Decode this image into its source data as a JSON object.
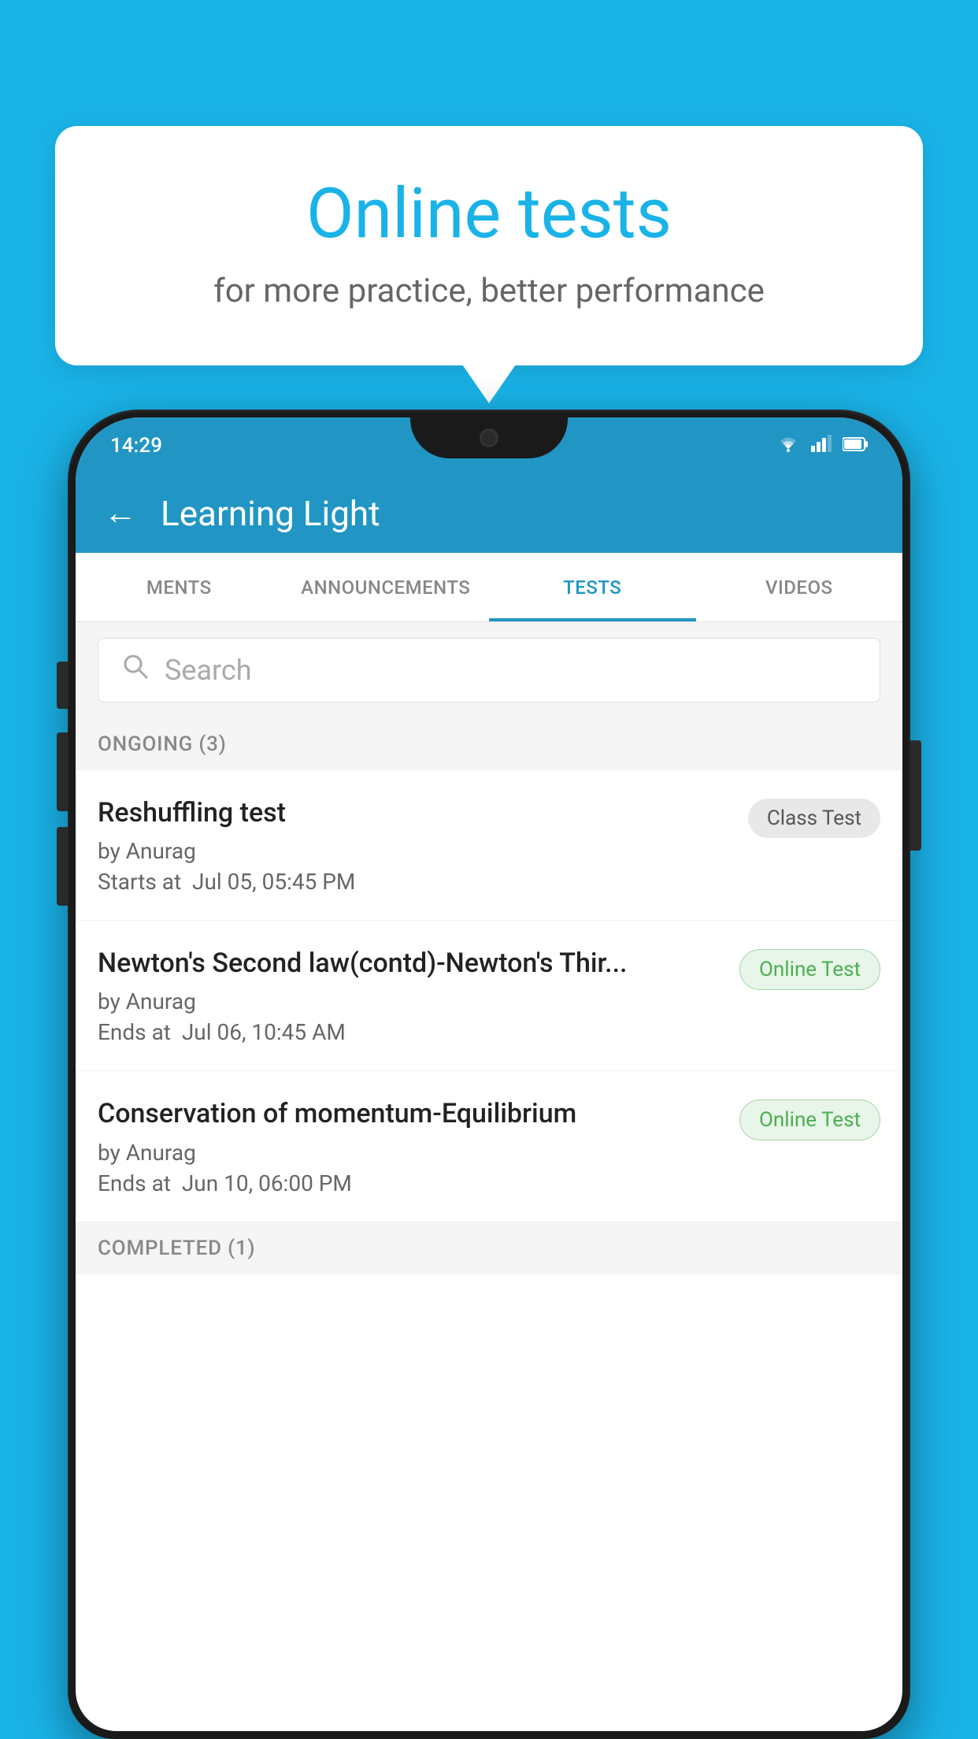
{
  "background": {
    "color": "#1ab3e8"
  },
  "bubble": {
    "title": "Online tests",
    "subtitle": "for more practice, better performance"
  },
  "phone": {
    "status": {
      "time": "14:29",
      "wifi_icon": "▾",
      "signal_icon": "▲",
      "battery_icon": "▮"
    },
    "header": {
      "back_label": "←",
      "title": "Learning Light"
    },
    "tabs": [
      {
        "label": "MENTS",
        "active": false
      },
      {
        "label": "ANNOUNCEMENTS",
        "active": false
      },
      {
        "label": "TESTS",
        "active": true
      },
      {
        "label": "VIDEOS",
        "active": false
      }
    ],
    "search": {
      "placeholder": "Search"
    },
    "ongoing_section": {
      "label": "ONGOING (3)"
    },
    "tests": [
      {
        "name": "Reshuffling test",
        "author": "by Anurag",
        "time_label": "Starts at",
        "time_value": "Jul 05, 05:45 PM",
        "badge": "Class Test",
        "badge_type": "class"
      },
      {
        "name": "Newton's Second law(contd)-Newton's Thir...",
        "author": "by Anurag",
        "time_label": "Ends at",
        "time_value": "Jul 06, 10:45 AM",
        "badge": "Online Test",
        "badge_type": "online"
      },
      {
        "name": "Conservation of momentum-Equilibrium",
        "author": "by Anurag",
        "time_label": "Ends at",
        "time_value": "Jun 10, 06:00 PM",
        "badge": "Online Test",
        "badge_type": "online"
      }
    ],
    "completed_section": {
      "label": "COMPLETED (1)"
    }
  }
}
